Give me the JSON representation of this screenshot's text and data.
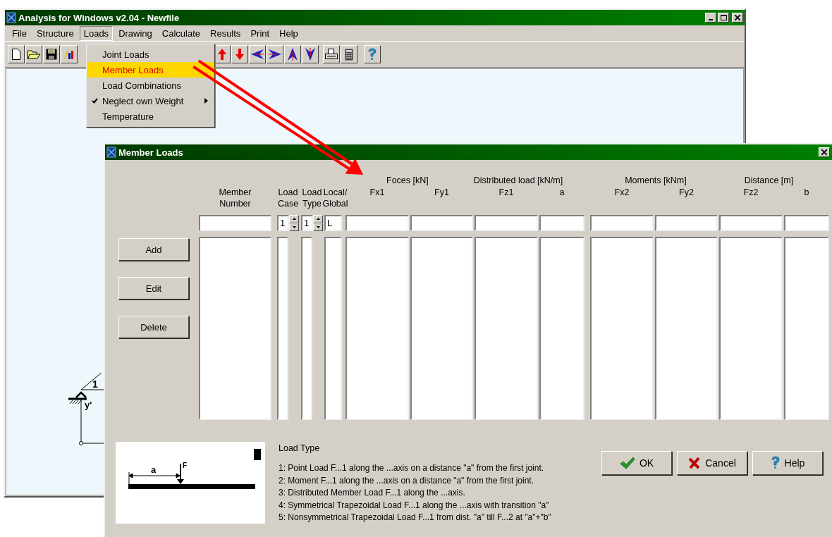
{
  "main_window": {
    "title": "Analysis for Windows v2.04 - Newfile",
    "menu": [
      {
        "label": "File",
        "selected": false
      },
      {
        "label": "Structure",
        "selected": false
      },
      {
        "label": "Loads",
        "selected": true
      },
      {
        "label": "Drawing",
        "selected": false
      },
      {
        "label": "Calculate",
        "selected": false
      },
      {
        "label": "Results",
        "selected": false
      },
      {
        "label": "Print",
        "selected": false
      },
      {
        "label": "Help",
        "selected": false
      }
    ],
    "loads_menu": [
      {
        "label": "Joint Loads",
        "selected": false,
        "checked": false,
        "submenu": false
      },
      {
        "label": "Member Loads",
        "selected": true,
        "checked": false,
        "submenu": false
      },
      {
        "label": "Load Combinations",
        "selected": false,
        "checked": false,
        "submenu": false
      },
      {
        "label": "Neglect own Weight",
        "selected": false,
        "checked": true,
        "submenu": true
      },
      {
        "label": "Temperature",
        "selected": false,
        "checked": false,
        "submenu": false
      }
    ],
    "canvas": {
      "labels": [
        "1",
        "y'"
      ]
    }
  },
  "dialog": {
    "title": "Member Loads",
    "column_groups": [
      "Foces [kN]",
      "Distributed load [kN/m]",
      "Moments [kNm]",
      "Distance [m]"
    ],
    "columns": [
      {
        "lines": [
          "Member",
          "Number"
        ]
      },
      {
        "lines": [
          "Load",
          "Case"
        ]
      },
      {
        "lines": [
          "Load",
          "Type"
        ]
      },
      {
        "lines": [
          "Local/",
          "Global"
        ]
      },
      {
        "lines": [
          "Fx1"
        ]
      },
      {
        "lines": [
          "Fy1"
        ]
      },
      {
        "lines": [
          "Fz1"
        ]
      },
      {
        "lines": [
          "a"
        ]
      },
      {
        "lines": [
          "Fx2"
        ]
      },
      {
        "lines": [
          "Fy2"
        ]
      },
      {
        "lines": [
          "Fz2"
        ]
      },
      {
        "lines": [
          "b"
        ]
      }
    ],
    "input_values": {
      "load_case": "1",
      "load_type": "1",
      "local_global": "L"
    },
    "buttons": [
      "Add",
      "Edit",
      "Delete"
    ],
    "load_type": {
      "title": "Load Type",
      "diagram_labels": [
        "a",
        "F"
      ],
      "lines": [
        "1: Point Load F...1 along the ...axis on a distance \"a\" from the first joint.",
        "2: Moment F...1 along the ...axis on a distance \"a\" from the first joint.",
        "3: Distributed Member Load F...1 along the ...axis.",
        "4: Symmetrical Trapezoidal Load F...1 along the ...axis with transition \"a\"",
        "5: Nonsymmetrical Trapezoidal Load F...1 from dist. \"a\" till F...2 at \"a\"+\"b\""
      ]
    },
    "action_buttons": [
      {
        "label": "OK",
        "kind": "ok"
      },
      {
        "label": "Cancel",
        "kind": "cancel"
      },
      {
        "label": "Help",
        "kind": "help"
      }
    ]
  }
}
